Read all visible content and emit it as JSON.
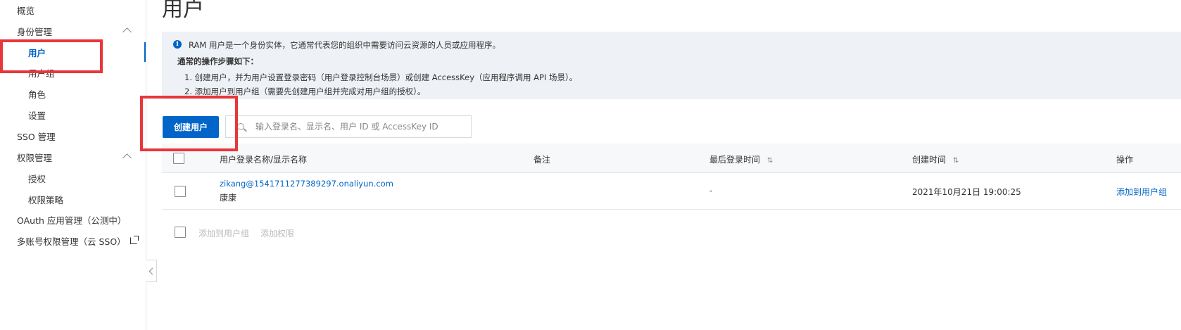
{
  "sidebar": {
    "items": [
      {
        "label": "概览"
      },
      {
        "label": "身份管理"
      },
      {
        "label": "用户"
      },
      {
        "label": "用户组"
      },
      {
        "label": "角色"
      },
      {
        "label": "设置"
      },
      {
        "label": "SSO 管理"
      },
      {
        "label": "权限管理"
      },
      {
        "label": "授权"
      },
      {
        "label": "权限策略"
      },
      {
        "label": "OAuth 应用管理（公测中）"
      },
      {
        "label": "多账号权限管理（云 SSO）"
      }
    ],
    "active_label": "用户"
  },
  "page": {
    "title": "用户"
  },
  "info": {
    "main": "RAM 用户是一个身份实体，它通常代表您的组织中需要访问云资源的人员或应用程序。",
    "steps_title": "通常的操作步骤如下：",
    "step1": "1. 创建用户，并为用户设置登录密码（用户登录控制台场景）或创建 AccessKey（应用程序调用 API 场景）。",
    "step2": "2. 添加用户到用户组（需要先创建用户组并完成对用户组的授权）。"
  },
  "toolbar": {
    "create_label": "创建用户",
    "search_placeholder": "输入登录名、显示名、用户 ID 或 AccessKey ID"
  },
  "table": {
    "headers": {
      "name": "用户登录名称/显示名称",
      "note": "备注",
      "last_login": "最后登录时间",
      "created": "创建时间",
      "actions": "操作"
    },
    "rows": [
      {
        "login": "zikang@1541711277389297.onaliyun.com",
        "display": "康康",
        "note": "",
        "last_login": "-",
        "created": "2021年10月21日 19:00:25",
        "action": "添加到用户组"
      }
    ]
  },
  "batch": {
    "add_to_group": "添加到用户组",
    "add_permission": "添加权限"
  },
  "colors": {
    "accent": "#0064c8",
    "highlight": "#e8363a",
    "info_bg": "#eef1f6"
  },
  "icons": {
    "info": "info-icon",
    "search": "search-icon",
    "sort": "sort-icon",
    "external": "external-link-icon",
    "collapse": "chevron-left-icon"
  }
}
